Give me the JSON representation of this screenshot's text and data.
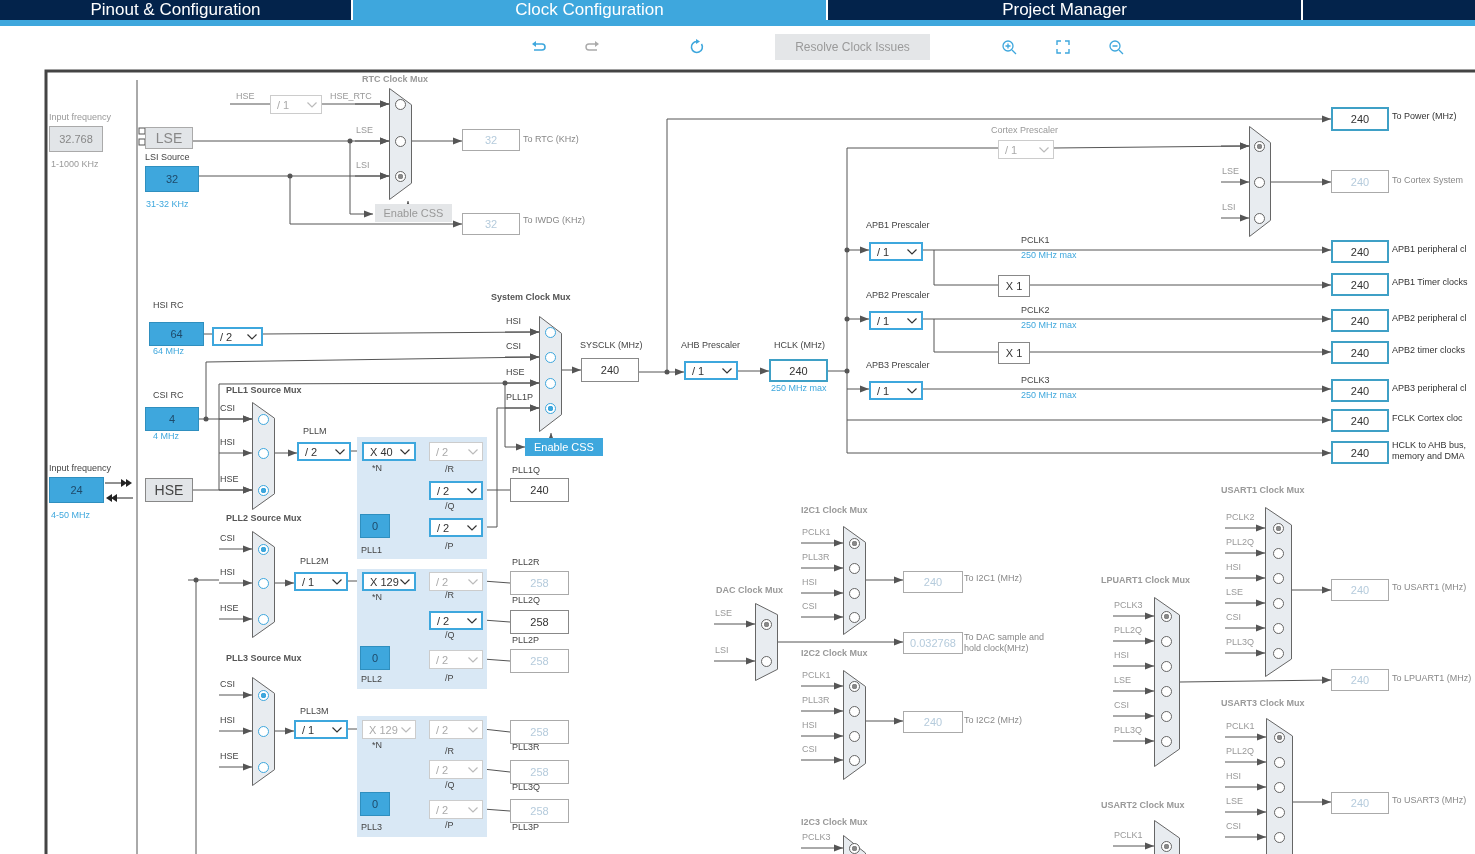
{
  "tabs": [
    {
      "label": "Pinout & Configuration",
      "selected": false
    },
    {
      "label": "Clock Configuration",
      "selected": true
    },
    {
      "label": "Project Manager",
      "selected": false
    }
  ],
  "toolbar": [
    {
      "kind": "undo",
      "disabled": false
    },
    {
      "kind": "redo",
      "disabled": true
    },
    {
      "kind": "refresh",
      "disabled": false
    },
    {
      "kind": "button",
      "label": "Resolve Clock Issues",
      "disabled": true
    },
    {
      "kind": "zoom-in",
      "disabled": false
    },
    {
      "kind": "fit",
      "disabled": false
    },
    {
      "kind": "zoom-out",
      "disabled": false
    }
  ],
  "diagram": {
    "labels": [
      {
        "text": "Input frequency",
        "kind": "muted"
      },
      {
        "text": "1-1000 KHz",
        "kind": "muted"
      },
      {
        "text": "HSE",
        "kind": "muted"
      },
      {
        "text": "HSE_RTC",
        "kind": "muted"
      },
      {
        "text": "RTC Clock Mux",
        "kind": "title-muted"
      },
      {
        "text": "LSI Source",
        "kind": "text"
      },
      {
        "text": "31-32 KHz",
        "kind": "note"
      },
      {
        "text": "To RTC (KHz)",
        "kind": "muted-bold"
      },
      {
        "text": "To IWDG (KHz)",
        "kind": "muted-bold"
      },
      {
        "text": "HSI RC",
        "kind": "text"
      },
      {
        "text": "64 MHz",
        "kind": "note"
      },
      {
        "text": "System Clock Mux",
        "kind": "title"
      },
      {
        "text": "SYSCLK (MHz)",
        "kind": "text"
      },
      {
        "text": "AHB Prescaler",
        "kind": "text"
      },
      {
        "text": "HCLK (MHz)",
        "kind": "text"
      },
      {
        "text": "250 MHz max",
        "kind": "note"
      },
      {
        "text": "CSI RC",
        "kind": "text"
      },
      {
        "text": "4 MHz",
        "kind": "note"
      },
      {
        "text": "PLL1 Source Mux",
        "kind": "title"
      },
      {
        "text": "PLLM",
        "kind": "text"
      },
      {
        "text": "Input frequency",
        "kind": "text"
      },
      {
        "text": "*N",
        "kind": "text"
      },
      {
        "text": "/R",
        "kind": "text"
      },
      {
        "text": "PLL1Q",
        "kind": "text"
      },
      {
        "text": "/Q",
        "kind": "text"
      },
      {
        "text": "4-50 MHz",
        "kind": "note"
      },
      {
        "text": "/P",
        "kind": "text"
      },
      {
        "text": "PLL1",
        "kind": "text"
      },
      {
        "text": "PLL2 Source Mux",
        "kind": "title"
      },
      {
        "text": "PLL2M",
        "kind": "text"
      },
      {
        "text": "PLL2R",
        "kind": "text"
      },
      {
        "text": "*N",
        "kind": "text"
      },
      {
        "text": "/R",
        "kind": "text"
      },
      {
        "text": "PLL2Q",
        "kind": "text"
      },
      {
        "text": "/Q",
        "kind": "text"
      },
      {
        "text": "PLL2P",
        "kind": "text"
      },
      {
        "text": "PLL2",
        "kind": "text"
      },
      {
        "text": "/P",
        "kind": "text"
      },
      {
        "text": "PLL3 Source Mux",
        "kind": "title"
      },
      {
        "text": "PLL3M",
        "kind": "text"
      },
      {
        "text": "*N",
        "kind": "text"
      },
      {
        "text": "/R",
        "kind": "text"
      },
      {
        "text": "PLL3R",
        "kind": "text"
      },
      {
        "text": "/Q",
        "kind": "text"
      },
      {
        "text": "PLL3Q",
        "kind": "text"
      },
      {
        "text": "PLL3",
        "kind": "text"
      },
      {
        "text": "/P",
        "kind": "text"
      },
      {
        "text": "PLL3P",
        "kind": "text"
      },
      {
        "text": "Cortex Prescaler",
        "kind": "muted"
      },
      {
        "text": "To Power (MHz)",
        "kind": "strong"
      },
      {
        "text": "To Cortex System",
        "kind": "muted-bold"
      },
      {
        "text": "APB1 Prescaler",
        "kind": "text"
      },
      {
        "text": "PCLK1",
        "kind": "text"
      },
      {
        "text": "250 MHz max",
        "kind": "note"
      },
      {
        "text": "APB1 peripheral cl",
        "kind": "strong"
      },
      {
        "text": "APB1 Timer clocks",
        "kind": "strong"
      },
      {
        "text": "APB2 Prescaler",
        "kind": "text"
      },
      {
        "text": "PCLK2",
        "kind": "text"
      },
      {
        "text": "250 MHz max",
        "kind": "note"
      },
      {
        "text": "APB2 peripheral cl",
        "kind": "strong"
      },
      {
        "text": "APB2 timer clocks",
        "kind": "strong"
      },
      {
        "text": "APB3 Prescaler",
        "kind": "text"
      },
      {
        "text": "PCLK3",
        "kind": "text"
      },
      {
        "text": "250 MHz max",
        "kind": "note"
      },
      {
        "text": "APB3 peripheral cl",
        "kind": "strong"
      },
      {
        "text": "FCLK Cortex cloc",
        "kind": "strong"
      },
      {
        "text": "HCLK to AHB bus, memory and DMA",
        "kind": "strong"
      },
      {
        "text": "I2C1 Clock Mux",
        "kind": "title-muted"
      },
      {
        "text": "To I2C1 (MHz)",
        "kind": "muted-bold"
      },
      {
        "text": "DAC Clock Mux",
        "kind": "title-muted"
      },
      {
        "text": "To DAC sample and hold clock(MHz)",
        "kind": "muted-bold"
      },
      {
        "text": "I2C2 Clock Mux",
        "kind": "title-muted"
      },
      {
        "text": "To I2C2 (MHz)",
        "kind": "muted-bold"
      },
      {
        "text": "I2C3 Clock Mux",
        "kind": "title-muted"
      },
      {
        "text": "USART1 Clock Mux",
        "kind": "title-muted"
      },
      {
        "text": "To USART1 (MHz)",
        "kind": "muted-bold"
      },
      {
        "text": "LPUART1 Clock Mux",
        "kind": "title-muted"
      },
      {
        "text": "To LPUART1 (MHz)",
        "kind": "muted-bold"
      },
      {
        "text": "USART3 Clock Mux",
        "kind": "title-muted"
      },
      {
        "text": "To USART3 (MHz)",
        "kind": "muted-bold"
      },
      {
        "text": "USART2 Clock Mux",
        "kind": "title-muted"
      }
    ],
    "boxes": [
      {
        "value": "32.768",
        "kind": "readonly"
      },
      {
        "value": "LSE",
        "kind": "oscillator-off"
      },
      {
        "value": "32",
        "kind": "input"
      },
      {
        "value": "32",
        "kind": "muted"
      },
      {
        "value": "32",
        "kind": "muted"
      },
      {
        "value": "64",
        "kind": "input"
      },
      {
        "value": "240",
        "kind": "plain"
      },
      {
        "value": "240",
        "kind": "output"
      },
      {
        "value": "4",
        "kind": "input"
      },
      {
        "value": "0",
        "kind": "input"
      },
      {
        "value": "24",
        "kind": "input"
      },
      {
        "value": "HSE",
        "kind": "oscillator"
      },
      {
        "value": "240",
        "kind": "plain"
      },
      {
        "value": "258",
        "kind": "muted"
      },
      {
        "value": "258",
        "kind": "plain"
      },
      {
        "value": "0",
        "kind": "input"
      },
      {
        "value": "258",
        "kind": "muted"
      },
      {
        "value": "258",
        "kind": "muted"
      },
      {
        "value": "258",
        "kind": "muted"
      },
      {
        "value": "0",
        "kind": "input"
      },
      {
        "value": "258",
        "kind": "muted"
      },
      {
        "value": "240",
        "kind": "output"
      },
      {
        "value": "240",
        "kind": "muted"
      },
      {
        "value": "240",
        "kind": "output"
      },
      {
        "value": "X 1",
        "kind": "plain"
      },
      {
        "value": "240",
        "kind": "output"
      },
      {
        "value": "240",
        "kind": "output"
      },
      {
        "value": "X 1",
        "kind": "plain"
      },
      {
        "value": "240",
        "kind": "output"
      },
      {
        "value": "240",
        "kind": "output"
      },
      {
        "value": "240",
        "kind": "output"
      },
      {
        "value": "240",
        "kind": "output"
      },
      {
        "value": "240",
        "kind": "muted"
      },
      {
        "value": "0.032768",
        "kind": "muted"
      },
      {
        "value": "240",
        "kind": "muted"
      },
      {
        "value": "240",
        "kind": "muted"
      },
      {
        "value": "240",
        "kind": "muted"
      },
      {
        "value": "240",
        "kind": "muted"
      }
    ],
    "dropdowns": [
      {
        "value": "/ 1",
        "disabled": true
      },
      {
        "value": "/ 2",
        "disabled": false
      },
      {
        "value": "/ 1",
        "disabled": false
      },
      {
        "value": "/ 2",
        "disabled": false
      },
      {
        "value": "X 40",
        "disabled": false
      },
      {
        "value": "/ 2",
        "disabled": true
      },
      {
        "value": "/ 2",
        "disabled": false
      },
      {
        "value": "/ 2",
        "disabled": false
      },
      {
        "value": "/ 1",
        "disabled": false
      },
      {
        "value": "X 129",
        "disabled": false
      },
      {
        "value": "/ 2",
        "disabled": true
      },
      {
        "value": "/ 2",
        "disabled": false
      },
      {
        "value": "/ 2",
        "disabled": true
      },
      {
        "value": "/ 1",
        "disabled": false
      },
      {
        "value": "X 129",
        "disabled": true
      },
      {
        "value": "/ 2",
        "disabled": true
      },
      {
        "value": "/ 2",
        "disabled": true
      },
      {
        "value": "/ 2",
        "disabled": true
      },
      {
        "value": "/ 1",
        "disabled": true
      },
      {
        "value": "/ 1",
        "disabled": false
      },
      {
        "value": "/ 1",
        "disabled": false
      },
      {
        "value": "/ 1",
        "disabled": false
      }
    ],
    "buttons": [
      {
        "label": "Enable CSS",
        "disabled": true
      },
      {
        "label": "Enable CSS",
        "disabled": false
      }
    ],
    "muxes": [
      {
        "disabled": true,
        "inputs": [
          {
            "selected": false
          },
          {
            "label": "LSE",
            "selected": false
          },
          {
            "label": "LSI",
            "selected": true
          }
        ]
      },
      {
        "disabled": false,
        "inputs": [
          {
            "label": "HSI",
            "selected": false
          },
          {
            "label": "CSI",
            "selected": false
          },
          {
            "label": "HSE",
            "selected": false
          },
          {
            "label": "PLL1P",
            "selected": true
          }
        ]
      },
      {
        "disabled": false,
        "inputs": [
          {
            "label": "CSI",
            "selected": false
          },
          {
            "label": "HSI",
            "selected": false
          },
          {
            "label": "HSE",
            "selected": true
          }
        ]
      },
      {
        "disabled": false,
        "inputs": [
          {
            "label": "CSI",
            "selected": true
          },
          {
            "label": "HSI",
            "selected": false
          },
          {
            "label": "HSE",
            "selected": false
          }
        ]
      },
      {
        "disabled": false,
        "inputs": [
          {
            "label": "CSI",
            "selected": true
          },
          {
            "label": "HSI",
            "selected": false
          },
          {
            "label": "HSE",
            "selected": false
          }
        ]
      },
      {
        "disabled": true,
        "inputs": [
          {
            "selected": true
          },
          {
            "label": "LSE",
            "selected": false
          },
          {
            "label": "LSI",
            "selected": false
          }
        ]
      },
      {
        "disabled": true,
        "inputs": [
          {
            "label": "PCLK1",
            "selected": true
          },
          {
            "label": "PLL3R",
            "selected": false
          },
          {
            "label": "HSI",
            "selected": false
          },
          {
            "label": "CSI",
            "selected": false
          }
        ]
      },
      {
        "disabled": true,
        "inputs": [
          {
            "label": "LSE",
            "selected": true
          },
          {
            "label": "LSI",
            "selected": false
          }
        ]
      },
      {
        "disabled": true,
        "inputs": [
          {
            "label": "PCLK1",
            "selected": true
          },
          {
            "label": "PLL3R",
            "selected": false
          },
          {
            "label": "HSI",
            "selected": false
          },
          {
            "label": "CSI",
            "selected": false
          }
        ]
      },
      {
        "disabled": true,
        "inputs": [
          {
            "label": "PCLK3",
            "selected": true
          }
        ]
      },
      {
        "disabled": true,
        "inputs": [
          {
            "label": "PCLK2",
            "selected": true
          },
          {
            "label": "PLL2Q",
            "selected": false
          },
          {
            "label": "HSI",
            "selected": false
          },
          {
            "label": "LSE",
            "selected": false
          },
          {
            "label": "CSI",
            "selected": false
          },
          {
            "label": "PLL3Q",
            "selected": false
          }
        ]
      },
      {
        "disabled": true,
        "inputs": [
          {
            "label": "PCLK3",
            "selected": true
          },
          {
            "label": "PLL2Q",
            "selected": false
          },
          {
            "label": "HSI",
            "selected": false
          },
          {
            "label": "LSE",
            "selected": false
          },
          {
            "label": "CSI",
            "selected": false
          },
          {
            "label": "PLL3Q",
            "selected": false
          }
        ]
      },
      {
        "disabled": true,
        "inputs": [
          {
            "label": "PCLK1",
            "selected": true
          },
          {
            "label": "PLL2Q",
            "selected": false
          },
          {
            "label": "HSI",
            "selected": false
          },
          {
            "label": "LSE",
            "selected": false
          },
          {
            "label": "CSI",
            "selected": false
          }
        ]
      },
      {
        "disabled": true,
        "inputs": [
          {
            "label": "PCLK1",
            "selected": true
          }
        ]
      }
    ]
  }
}
